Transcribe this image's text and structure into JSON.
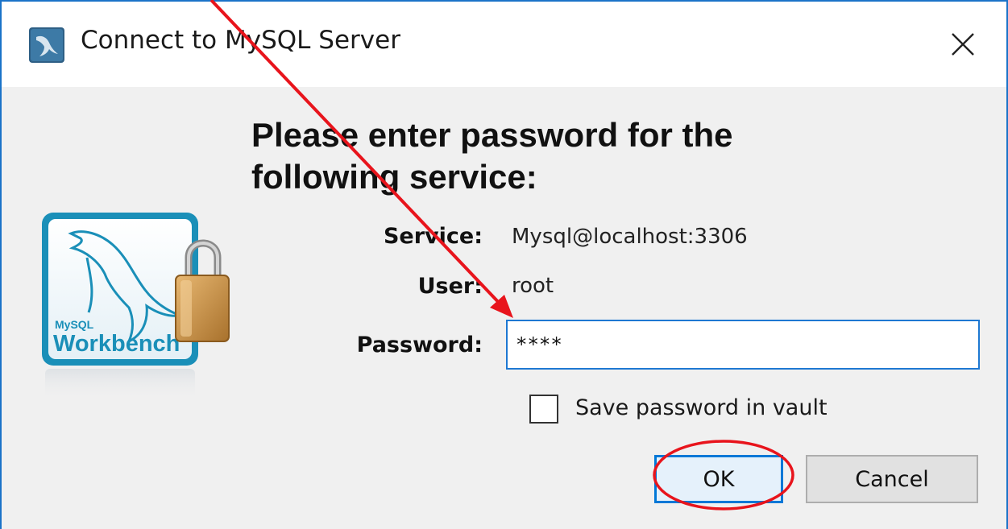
{
  "window": {
    "title": "Connect to MySQL Server"
  },
  "dialog": {
    "heading": "Please enter password for the following service:",
    "service_label": "Service:",
    "service_value": "Mysql@localhost:3306",
    "user_label": "User:",
    "user_value": "root",
    "password_label": "Password:",
    "password_value": "****",
    "save_password_label": "Save password in vault",
    "save_password_checked": false,
    "ok_label": "OK",
    "cancel_label": "Cancel"
  },
  "logo": {
    "brand_small": "MySQL",
    "brand_name": "Workbench"
  },
  "icons": {
    "title_icon": "mysql-dolphin-icon",
    "close_icon": "close-icon",
    "logo_icon": "workbench-logo-icon",
    "lock_icon": "padlock-icon"
  },
  "colors": {
    "accent": "#0078d7",
    "annotation": "#e8141c",
    "logo_blue": "#1a8fb8"
  }
}
